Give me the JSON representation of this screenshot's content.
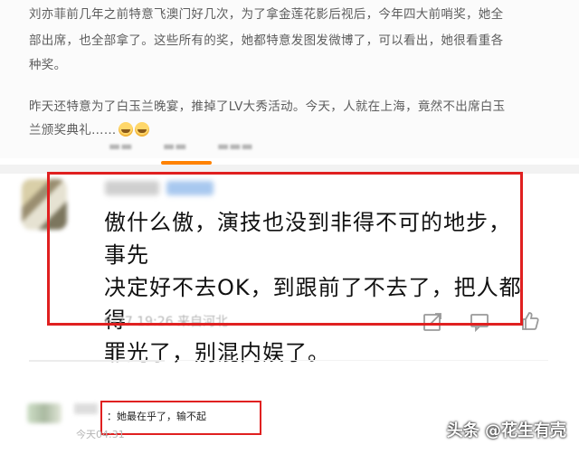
{
  "post": {
    "lines": [
      "刘亦菲前几年之前特意飞澳门好几次，为了拿金莲花影后视后，今年四大前哨奖，她全",
      "部出席，也全部拿了。这些所有的奖，她都特意发图发微博了，可以看出，她很看重各",
      "种奖。",
      "昨天还特意为了白玉兰晚宴，推掉了LV大秀活动。今天，人就在上海，竟然不出席白玉",
      "兰颁奖典礼……"
    ],
    "emoji_icons": [
      "crying-face-icon",
      "crying-face-icon"
    ]
  },
  "comment": {
    "lines": [
      "傲什么傲，演技也没到非得不可的地步，事先",
      "决定好不去OK，到跟前了不去了，把人都得",
      "罪光了，别混内娱了。"
    ],
    "meta": "6-27 19:26 来自河北",
    "actions": [
      "share-icon",
      "comment-icon",
      "like-icon"
    ]
  },
  "reply": {
    "text": "：她最在乎了，输不起",
    "time": "今天04:31"
  },
  "watermark": "头条 @花生有壳",
  "colors": {
    "highlight": "#e02020",
    "tab_accent": "#ff8200"
  }
}
